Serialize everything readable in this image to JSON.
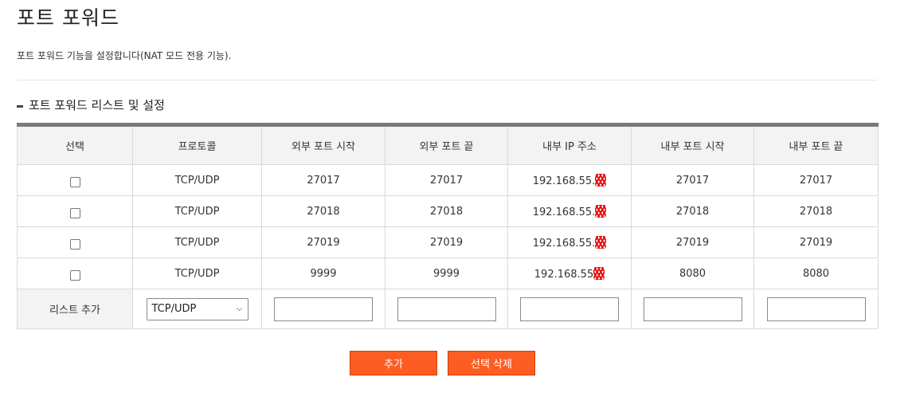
{
  "page": {
    "title": "포트 포워드",
    "description": "포트 포워드 기능을 설정합니다(NAT 모드 전용 기능).",
    "section_title": "포트 포워드 리스트 및 설정"
  },
  "table": {
    "headers": [
      "선택",
      "프로토콜",
      "외부 포트 시작",
      "외부 포트 끝",
      "내부 IP 주소",
      "내부 포트 시작",
      "내부 포트 끝"
    ],
    "rows": [
      {
        "checked": false,
        "protocol": "TCP/UDP",
        "ext_start": "27017",
        "ext_end": "27017",
        "ip": "192.168.55.",
        "int_start": "27017",
        "int_end": "27017"
      },
      {
        "checked": false,
        "protocol": "TCP/UDP",
        "ext_start": "27018",
        "ext_end": "27018",
        "ip": "192.168.55.",
        "int_start": "27018",
        "int_end": "27018"
      },
      {
        "checked": false,
        "protocol": "TCP/UDP",
        "ext_start": "27019",
        "ext_end": "27019",
        "ip": "192.168.55.",
        "int_start": "27019",
        "int_end": "27019"
      },
      {
        "checked": false,
        "protocol": "TCP/UDP",
        "ext_start": "9999",
        "ext_end": "9999",
        "ip": "192.168.55",
        "int_start": "8080",
        "int_end": "8080"
      }
    ],
    "add_row": {
      "label": "리스트 추가",
      "protocol_selected": "TCP/UDP"
    }
  },
  "buttons": {
    "add": "추가",
    "delete_selected": "선택 삭제"
  },
  "colors": {
    "accent": "#fd5d22",
    "header_bg": "#f3f3f3",
    "table_top_border": "#7a7a7a",
    "redaction": "#e81010"
  }
}
